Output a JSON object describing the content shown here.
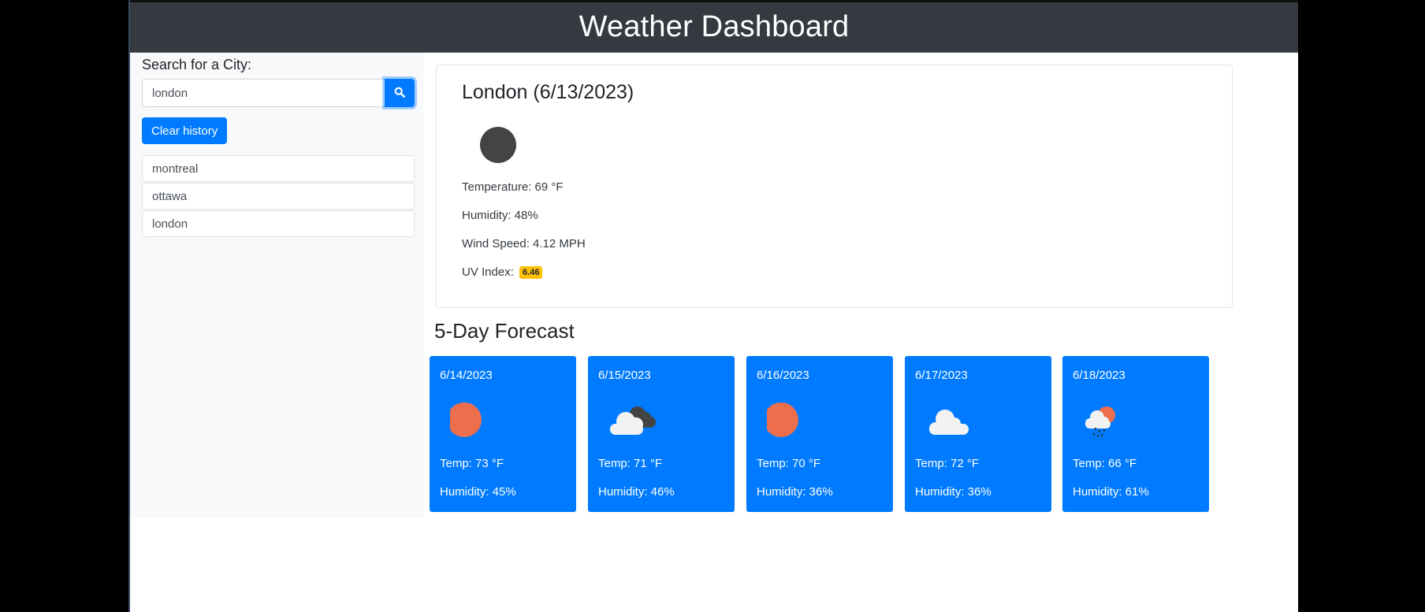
{
  "header": {
    "title": "Weather Dashboard"
  },
  "sidebar": {
    "search_label": "Search for a City:",
    "search_value": "london",
    "search_icon": "search-icon",
    "clear_button": "Clear history",
    "history": [
      {
        "label": "montreal"
      },
      {
        "label": "ottawa"
      },
      {
        "label": "london"
      }
    ]
  },
  "current": {
    "title": "London (6/13/2023)",
    "icon": "night-dark-circle-icon",
    "temperature": "Temperature: 69 °F",
    "humidity": "Humidity: 48%",
    "wind": "Wind Speed: 4.12 MPH",
    "uv_label": "UV Index:",
    "uv_value": "6.46",
    "uv_color": "#ffc107"
  },
  "forecast": {
    "title": "5-Day Forecast",
    "card_color": "#007bff",
    "days": [
      {
        "date": "6/14/2023",
        "icon": "sun-icon",
        "temp": "Temp: 73 °F",
        "humidity": "Humidity: 45%"
      },
      {
        "date": "6/15/2023",
        "icon": "clouds-icon",
        "temp": "Temp: 71 °F",
        "humidity": "Humidity: 46%"
      },
      {
        "date": "6/16/2023",
        "icon": "sun-icon",
        "temp": "Temp: 70 °F",
        "humidity": "Humidity: 36%"
      },
      {
        "date": "6/17/2023",
        "icon": "cloud-icon",
        "temp": "Temp: 72 °F",
        "humidity": "Humidity: 36%"
      },
      {
        "date": "6/18/2023",
        "icon": "rain-sun-icon",
        "temp": "Temp: 66 °F",
        "humidity": "Humidity: 61%"
      }
    ]
  }
}
